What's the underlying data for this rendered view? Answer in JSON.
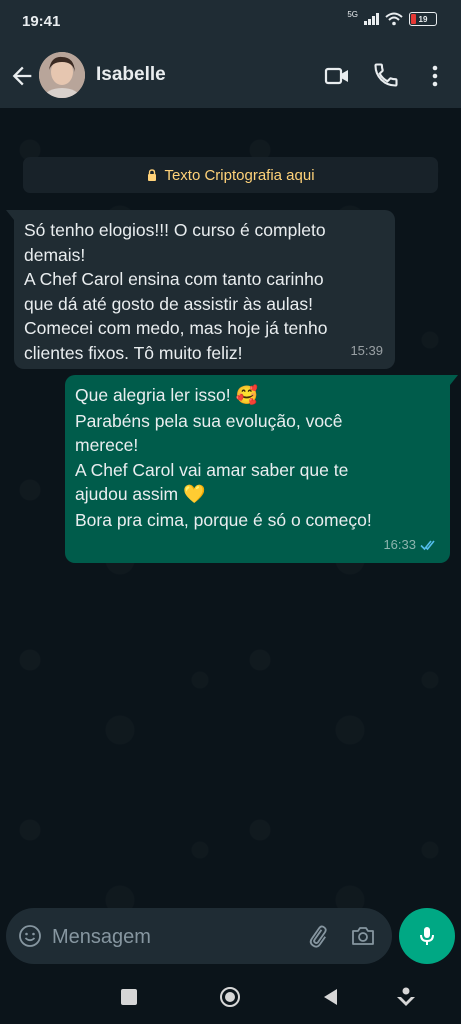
{
  "status_bar": {
    "time": "19:41",
    "network": "5G",
    "battery": "19",
    "battery_level": 0.19
  },
  "header": {
    "contact_name": "Isabelle",
    "icons": [
      "back-arrow-icon",
      "avatar",
      "video-call-icon",
      "voice-call-icon",
      "more-options-icon"
    ]
  },
  "chat": {
    "encryption_notice": "Texto Criptografia aqui",
    "messages": [
      {
        "direction": "incoming",
        "lines": [
          "Só tenho elogios!!! O curso é completo",
          "demais!",
          "A Chef Carol ensina com tanto carinho",
          "que dá até gosto de assistir às aulas!",
          "Comecei com medo, mas hoje já tenho",
          "clientes fixos. Tô muito feliz!"
        ],
        "time": "15:39"
      },
      {
        "direction": "outgoing",
        "lines": [
          "Que alegria ler isso!",
          "Parabéns pela sua evolução, você",
          "merece!",
          "A Chef Carol vai amar saber que te",
          "ajudou assim",
          "Bora pra cima, porque é só o começo!"
        ],
        "emoji_1": "🥰",
        "emoji_2": "💛",
        "time": "16:33",
        "status": "read"
      }
    ]
  },
  "composer": {
    "placeholder": "Mensagem"
  },
  "colors": {
    "header_bg": "#1f2c34",
    "chat_bg": "#0b141a",
    "incoming_bubble": "#202c33",
    "outgoing_bubble": "#005c4b",
    "accent": "#00a884",
    "read_tick": "#53bdeb",
    "encryption_text": "#ffd279"
  }
}
